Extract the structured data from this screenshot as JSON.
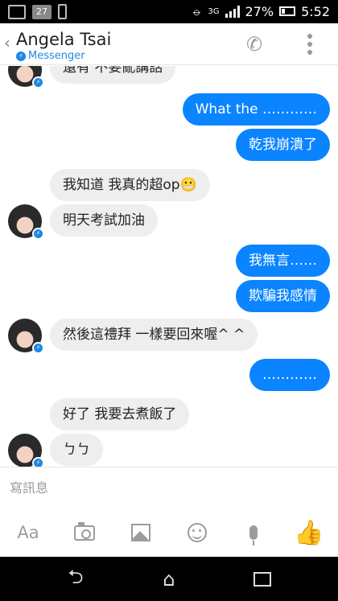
{
  "status_bar": {
    "notification_badge": "27",
    "network": "3G",
    "battery": "27%",
    "time": "5:52"
  },
  "header": {
    "back_icon": "chevron-left-icon",
    "title": "Angela Tsai",
    "subtitle": "Messenger",
    "call_icon": "phone-icon",
    "more_icon": "more-vertical-icon"
  },
  "messages": [
    {
      "sender": "them",
      "text": "還有 不要亂講話"
    },
    {
      "sender": "me",
      "text": "What the …………"
    },
    {
      "sender": "me",
      "text": "乾我崩潰了"
    },
    {
      "sender": "them",
      "text": "我知道 我真的超op😬"
    },
    {
      "sender": "them",
      "text": "明天考試加油"
    },
    {
      "sender": "me",
      "text": "我無言……"
    },
    {
      "sender": "me",
      "text": "欺騙我感情"
    },
    {
      "sender": "them",
      "text": "然後這禮拜 一樣要回來喔^ ^"
    },
    {
      "sender": "me",
      "text": "…………"
    },
    {
      "sender": "them",
      "text": "好了 我要去煮飯了"
    },
    {
      "sender": "them",
      "text": "ㄅㄅ"
    }
  ],
  "composer": {
    "placeholder": "寫訊息"
  },
  "toolbar": {
    "text_label": "Aa",
    "camera_icon": "camera-icon",
    "image_icon": "image-icon",
    "emoji_icon": "emoji-icon",
    "mic_icon": "microphone-icon",
    "like_icon": "thumbs-up-icon"
  },
  "colors": {
    "accent": "#0a84ff",
    "incoming_bubble": "#eeeeee"
  }
}
